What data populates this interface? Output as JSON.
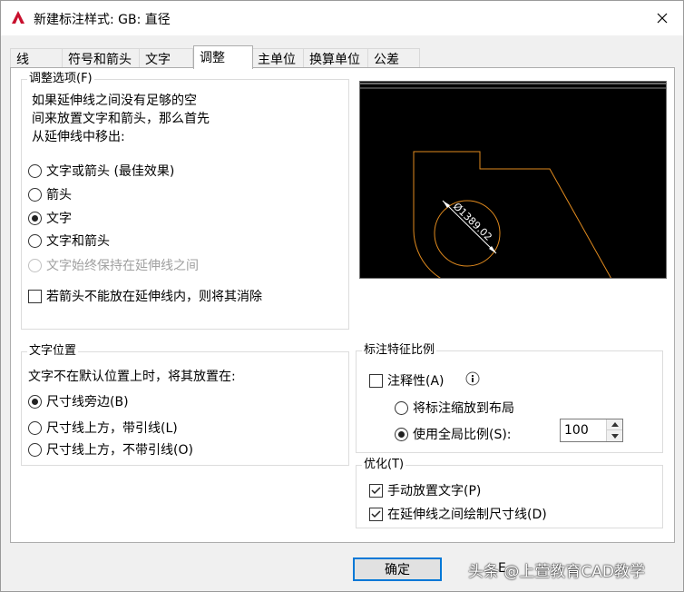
{
  "window": {
    "title": "新建标注样式: GB: 直径"
  },
  "tabs": [
    {
      "label": "线"
    },
    {
      "label": "符号和箭头"
    },
    {
      "label": "文字"
    },
    {
      "label": "调整",
      "active": true
    },
    {
      "label": "主单位"
    },
    {
      "label": "换算单位"
    },
    {
      "label": "公差"
    }
  ],
  "fit_options": {
    "title": "调整选项(F)",
    "description": [
      "如果延伸线之间没有足够的空",
      "间来放置文字和箭头，那么首先",
      "从延伸线中移出:"
    ],
    "radios": [
      {
        "label": "文字或箭头 (最佳效果)",
        "selected": false,
        "enabled": true
      },
      {
        "label": "箭头",
        "selected": false,
        "enabled": true
      },
      {
        "label": "文字",
        "selected": true,
        "enabled": true
      },
      {
        "label": "文字和箭头",
        "selected": false,
        "enabled": true
      },
      {
        "label": "文字始终保持在延伸线之间",
        "selected": false,
        "enabled": false
      }
    ],
    "suppress_checkbox": {
      "label": "若箭头不能放在延伸线内，则将其消除",
      "checked": false
    }
  },
  "preview": {
    "dimension_text": "Ø1389.02",
    "line_color": "#e08a1e",
    "background": "#000000"
  },
  "text_placement": {
    "title": "文字位置",
    "description": "文字不在默认位置上时，将其放置在:",
    "radios": [
      {
        "label": "尺寸线旁边(B)",
        "selected": true
      },
      {
        "label": "尺寸线上方，带引线(L)",
        "selected": false
      },
      {
        "label": "尺寸线上方，不带引线(O)",
        "selected": false
      }
    ]
  },
  "scale": {
    "title": "标注特征比例",
    "annotative": {
      "label": "注释性(A)",
      "checked": false
    },
    "info_icon": "info-icon",
    "radios": [
      {
        "label": "将标注缩放到布局",
        "selected": false
      },
      {
        "label": "使用全局比例(S):",
        "selected": true
      }
    ],
    "global_scale_value": "100"
  },
  "fine_tuning": {
    "title": "优化(T)",
    "checks": [
      {
        "label": "手动放置文字(P)",
        "checked": true
      },
      {
        "label": "在延伸线之间绘制尺寸线(D)",
        "checked": true
      }
    ]
  },
  "footer": {
    "ok_label": "确定",
    "help_partial": "E",
    "watermark": "头条 @上萱教育CAD教学"
  }
}
